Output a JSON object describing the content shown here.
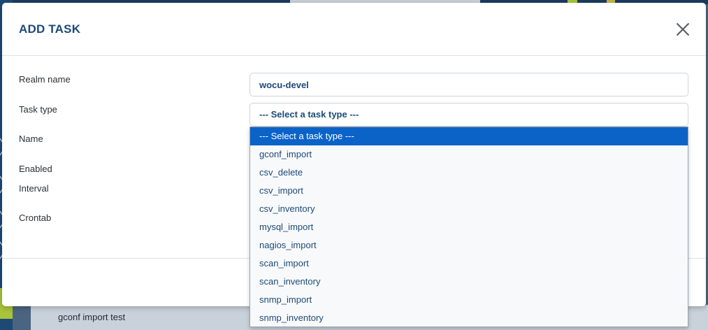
{
  "background": {
    "table_row_text": "gconf import test"
  },
  "modal": {
    "title": "ADD TASK",
    "fields": {
      "realm_name": {
        "label": "Realm name",
        "value": "wocu-devel"
      },
      "task_type": {
        "label": "Task type",
        "selected": "--- Select a task type ---"
      },
      "name": {
        "label": "Name"
      },
      "enabled": {
        "label": "Enabled"
      },
      "interval": {
        "label": "Interval"
      },
      "crontab": {
        "label": "Crontab"
      }
    },
    "task_type_options": [
      "--- Select a task type ---",
      "gconf_import",
      "csv_delete",
      "csv_import",
      "csv_inventory",
      "mysql_import",
      "nagios_import",
      "scan_import",
      "scan_inventory",
      "snmp_import",
      "snmp_inventory"
    ]
  },
  "colors": {
    "title": "#1c4a78",
    "option_text": "#1c4a78",
    "option_highlight": "#0b63c8",
    "sidebar": "#1d4a75",
    "sidebar_accent": "#a8c43a"
  }
}
